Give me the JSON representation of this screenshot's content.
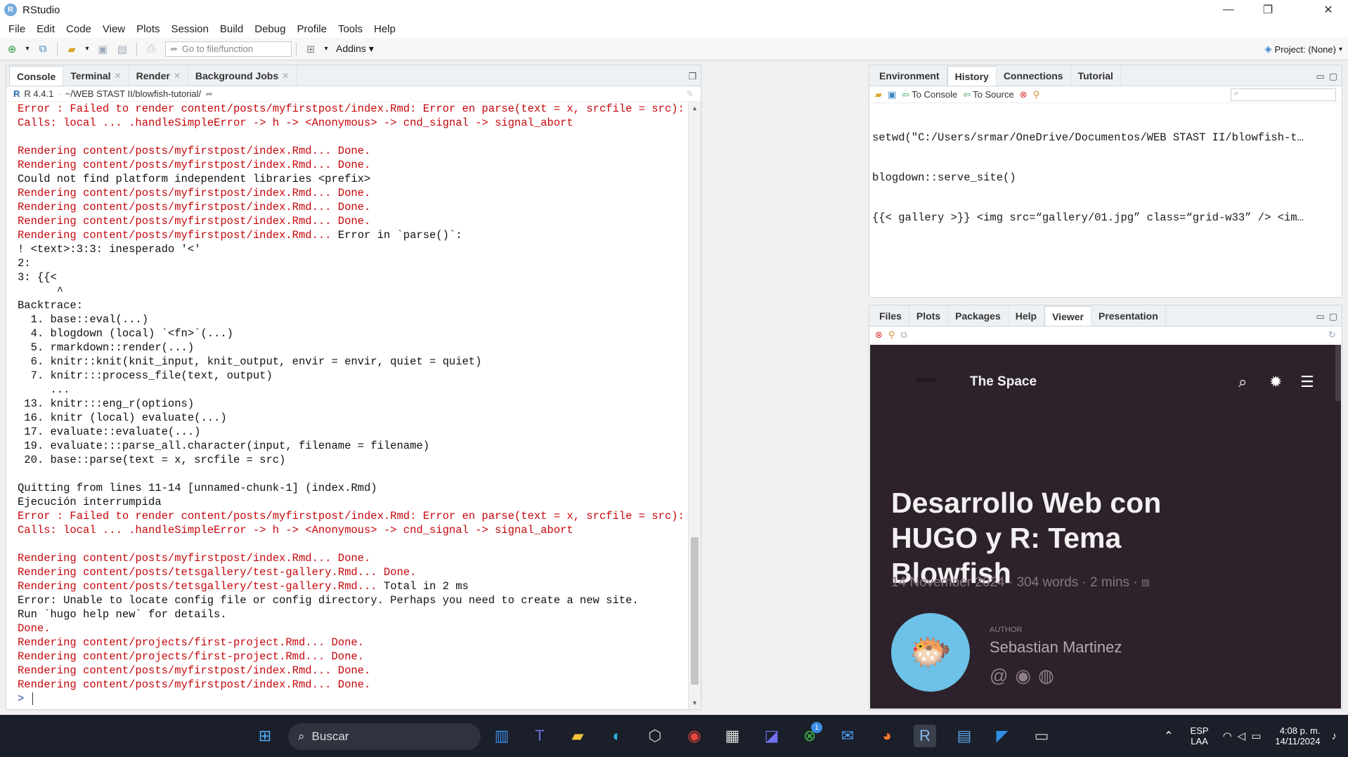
{
  "window": {
    "title": "RStudio"
  },
  "menu": [
    "File",
    "Edit",
    "Code",
    "View",
    "Plots",
    "Session",
    "Build",
    "Debug",
    "Profile",
    "Tools",
    "Help"
  ],
  "toolbar": {
    "goto_placeholder": "Go to file/function",
    "addins": "Addins",
    "project": "Project: (None)"
  },
  "left_tabs": [
    {
      "label": "Console",
      "closable": false
    },
    {
      "label": "Terminal",
      "closable": true
    },
    {
      "label": "Render",
      "closable": true
    },
    {
      "label": "Background Jobs",
      "closable": true
    }
  ],
  "console": {
    "version": "R 4.4.1",
    "path": "~/WEB STAST II/blowfish-tutorial/",
    "lines": [
      {
        "t": "Error : Failed to render content/posts/myfirstpost/index.Rmd: Error en parse(text = x, srcfile = src):",
        "c": "red"
      },
      {
        "t": "Calls: local ... .handleSimpleError -> h -> <Anonymous> -> cnd_signal -> signal_abort",
        "c": "red"
      },
      {
        "t": "",
        "c": "black"
      },
      {
        "t": "Rendering content/posts/myfirstpost/index.Rmd... Done.",
        "c": "red"
      },
      {
        "t": "Rendering content/posts/myfirstpost/index.Rmd... Done.",
        "c": "red"
      },
      {
        "t": "Could not find platform independent libraries <prefix>",
        "c": "black"
      },
      {
        "t": "Rendering content/posts/myfirstpost/index.Rmd... Done.",
        "c": "red"
      },
      {
        "t": "Rendering content/posts/myfirstpost/index.Rmd... Done.",
        "c": "red"
      },
      {
        "t": "Rendering content/posts/myfirstpost/index.Rmd... Done.",
        "c": "red"
      },
      {
        "t": "Rendering content/posts/myfirstpost/index.Rmd... Error in `parse()`:",
        "c": "mixed",
        "a": "Rendering content/posts/myfirstpost/index.Rmd...",
        "b": " Error in `parse()`:"
      },
      {
        "t": "! <text>:3:3: inesperado '<'",
        "c": "black"
      },
      {
        "t": "2:",
        "c": "black"
      },
      {
        "t": "3: {{<",
        "c": "black"
      },
      {
        "t": "      ^",
        "c": "black"
      },
      {
        "t": "Backtrace:",
        "c": "black"
      },
      {
        "t": "  1. base::eval(...)",
        "c": "black"
      },
      {
        "t": "  4. blogdown (local) `<fn>`(...)",
        "c": "black"
      },
      {
        "t": "  5. rmarkdown::render(...)",
        "c": "black"
      },
      {
        "t": "  6. knitr::knit(knit_input, knit_output, envir = envir, quiet = quiet)",
        "c": "black"
      },
      {
        "t": "  7. knitr:::process_file(text, output)",
        "c": "black"
      },
      {
        "t": "     ...",
        "c": "black"
      },
      {
        "t": " 13. knitr:::eng_r(options)",
        "c": "black"
      },
      {
        "t": " 16. knitr (local) evaluate(...)",
        "c": "black"
      },
      {
        "t": " 17. evaluate::evaluate(...)",
        "c": "black"
      },
      {
        "t": " 19. evaluate:::parse_all.character(input, filename = filename)",
        "c": "black"
      },
      {
        "t": " 20. base::parse(text = x, srcfile = src)",
        "c": "black"
      },
      {
        "t": "",
        "c": "black"
      },
      {
        "t": "Quitting from lines 11-14 [unnamed-chunk-1] (index.Rmd)",
        "c": "black"
      },
      {
        "t": "Ejecución interrumpida",
        "c": "black"
      },
      {
        "t": "Error : Failed to render content/posts/myfirstpost/index.Rmd: Error en parse(text = x, srcfile = src):",
        "c": "red"
      },
      {
        "t": "Calls: local ... .handleSimpleError -> h -> <Anonymous> -> cnd_signal -> signal_abort",
        "c": "red"
      },
      {
        "t": "",
        "c": "black"
      },
      {
        "t": "Rendering content/posts/myfirstpost/index.Rmd... Done.",
        "c": "red"
      },
      {
        "t": "Rendering content/posts/tetsgallery/test-gallery.Rmd... Done.",
        "c": "red"
      },
      {
        "t": "Rendering content/posts/tetsgallery/test-gallery.Rmd... Total in 2 ms",
        "c": "mixed",
        "a": "Rendering content/posts/tetsgallery/test-gallery.Rmd...",
        "b": " Total in 2 ms"
      },
      {
        "t": "Error: Unable to locate config file or config directory. Perhaps you need to create a new site.",
        "c": "black"
      },
      {
        "t": "Run `hugo help new` for details.",
        "c": "black"
      },
      {
        "t": "Done.",
        "c": "red"
      },
      {
        "t": "Rendering content/projects/first-project.Rmd... Done.",
        "c": "red"
      },
      {
        "t": "Rendering content/projects/first-project.Rmd... Done.",
        "c": "red"
      },
      {
        "t": "Rendering content/posts/myfirstpost/index.Rmd... Done.",
        "c": "red"
      },
      {
        "t": "Rendering content/posts/myfirstpost/index.Rmd... Done.",
        "c": "red"
      }
    ],
    "prompt": "> "
  },
  "right_top_tabs": [
    "Environment",
    "History",
    "Connections",
    "Tutorial"
  ],
  "history": {
    "to_console": "To Console",
    "to_source": "To Source",
    "lines": [
      "setwd(\"C:/Users/srmar/OneDrive/Documentos/WEB STAST II/blowfish-t…",
      "blogdown::serve_site()",
      "{{< gallery >}} <img src=“gallery/01.jpg” class=“grid-w33” /> <im…"
    ]
  },
  "right_bottom_tabs": [
    "Files",
    "Plots",
    "Packages",
    "Help",
    "Viewer",
    "Presentation"
  ],
  "viewer": {
    "logo": "space",
    "brand": "The Space",
    "heading": "Desarrollo Web con HUGO y R: Tema Blowfish",
    "meta": "14 November 2024 · 304 words · 2 mins · ",
    "author_label": "AUTHOR",
    "author_name": "Sebastian Martinez"
  },
  "taskbar": {
    "search": "Buscar",
    "lang1": "ESP",
    "lang2": "LAA",
    "time": "4:08 p. m.",
    "date": "14/11/2024",
    "teams_badge": "1"
  }
}
